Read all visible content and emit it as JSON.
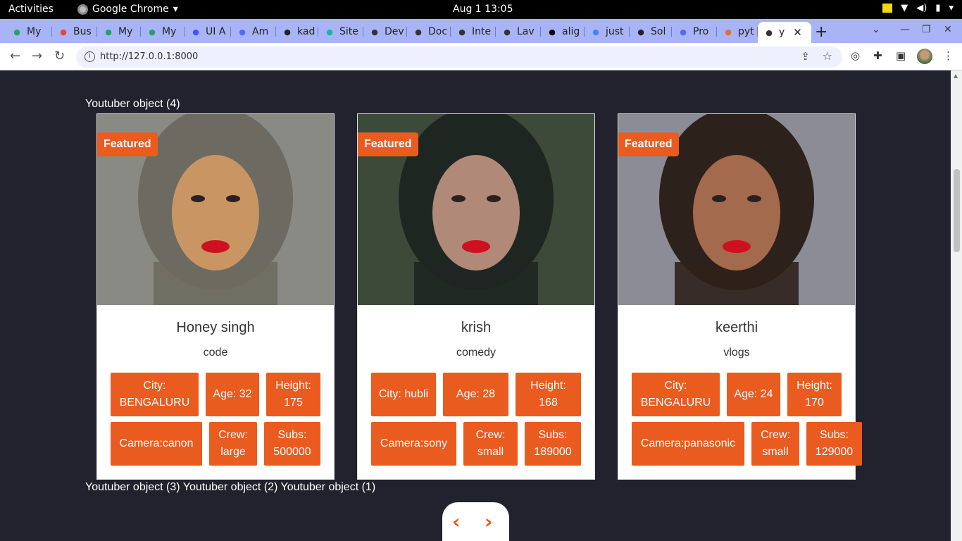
{
  "system_bar": {
    "activities": "Activities",
    "app_name": "Google Chrome",
    "clock": "Aug 1  13:05"
  },
  "tabs": [
    {
      "title": "My",
      "icon": "drive-icon",
      "color": "#1fa463"
    },
    {
      "title": "Bus",
      "icon": "gmail-icon",
      "color": "#ea4335"
    },
    {
      "title": "My",
      "icon": "drive-icon",
      "color": "#1fa463"
    },
    {
      "title": "My",
      "icon": "drive-icon",
      "color": "#1fa463"
    },
    {
      "title": "UI A",
      "icon": "webflow-icon",
      "color": "#4353ff"
    },
    {
      "title": "Am",
      "icon": "codepen-icon",
      "color": "#5468ff"
    },
    {
      "title": "kad",
      "icon": "github-icon",
      "color": "#222222"
    },
    {
      "title": "Site",
      "icon": "diamond-icon",
      "color": "#16b6a0"
    },
    {
      "title": "Dev",
      "icon": "globe-icon",
      "color": "#333333"
    },
    {
      "title": "Doc",
      "icon": "globe-icon",
      "color": "#333333"
    },
    {
      "title": "Inte",
      "icon": "globe-icon",
      "color": "#333333"
    },
    {
      "title": "Lav",
      "icon": "globe-icon",
      "color": "#333333"
    },
    {
      "title": "alig",
      "icon": "m-icon",
      "color": "#000000"
    },
    {
      "title": "just",
      "icon": "google-icon",
      "color": "#4285f4"
    },
    {
      "title": "Sol",
      "icon": "github-icon",
      "color": "#222222"
    },
    {
      "title": "Pro",
      "icon": "codepen-icon",
      "color": "#5468ff"
    },
    {
      "title": "pyt",
      "icon": "python-icon",
      "color": "#e86c2c"
    },
    {
      "title": "y",
      "icon": "globe-icon",
      "color": "#333333",
      "active": true
    }
  ],
  "address_bar": {
    "url": "http://127.0.0.1:8000"
  },
  "page": {
    "heading": "Youtuber object (4)",
    "others": "Youtuber object (3) Youtuber object (2) Youtuber object (1)",
    "badge_label": "Featured",
    "cards": [
      {
        "name": "Honey singh",
        "category": "code",
        "city": "City: BENGALURU",
        "age": "Age: 32",
        "height": "Height: 175",
        "camera": "Camera:canon",
        "crew": "Crew: large",
        "subs": "Subs: 500000",
        "photo_colors": [
          "#8a8a84",
          "#c99663",
          "#6d6b61"
        ]
      },
      {
        "name": "krish",
        "category": "comedy",
        "city": "City: hubli",
        "age": "Age: 28",
        "height": "Height: 168",
        "camera": "Camera:sony",
        "crew": "Crew: small",
        "subs": "Subs: 189000",
        "photo_colors": [
          "#3d4a3a",
          "#b08978",
          "#1e2622"
        ]
      },
      {
        "name": "keerthi",
        "category": "vlogs",
        "city": "City: BENGALURU",
        "age": "Age: 24",
        "height": "Height: 170",
        "camera": "Camera:panasonic",
        "crew": "Crew: small",
        "subs": "Subs: 129000",
        "photo_colors": [
          "#8c8c96",
          "#a36a4d",
          "#2d211b"
        ]
      }
    ]
  },
  "colors": {
    "accent": "#ea5b1f",
    "page_bg": "#22222e",
    "tabstrip": "#a9b4f7"
  }
}
